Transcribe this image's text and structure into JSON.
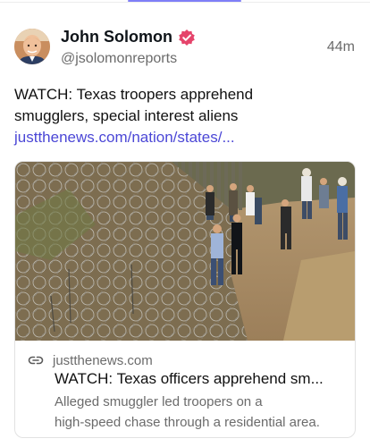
{
  "post": {
    "author": {
      "display_name": "John Solomon",
      "handle": "@jsolomonreports",
      "verified": true,
      "avatar_icon": "avatar-photo"
    },
    "timestamp": "44m",
    "text_line1": "WATCH: Texas troopers apprehend",
    "text_line2": "smugglers, special interest aliens",
    "link_text": "justthenews.com/nation/states/..."
  },
  "link_card": {
    "image_alt": "Officers with detained men near razor wire at the border fence",
    "domain": "justthenews.com",
    "title": "WATCH: Texas officers apprehend sm...",
    "description_line1": "Alleged smuggler led troopers on a",
    "description_line2": "high-speed chase through a residential area."
  },
  "colors": {
    "link": "#4b47d6",
    "verified_badge": "#e5446b",
    "secondary_text": "#6b6b6b",
    "tab_indicator": "#7f7ff7"
  }
}
